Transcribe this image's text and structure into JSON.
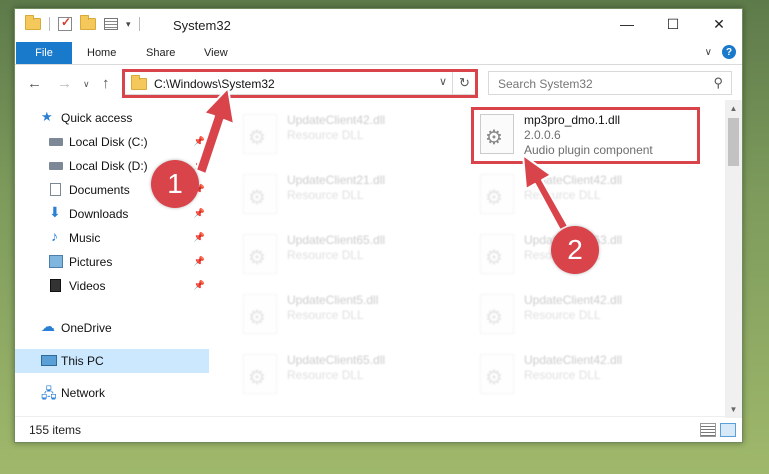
{
  "window": {
    "title": "System32",
    "controls": {
      "minimize": "—",
      "maximize": "☐",
      "close": "✕"
    }
  },
  "ribbon": {
    "file": "File",
    "tabs": [
      "Home",
      "Share",
      "View"
    ],
    "help": "?",
    "expand": "∨"
  },
  "nav": {
    "back": "←",
    "forward": "→",
    "recent": "∨",
    "up": "↑"
  },
  "address": {
    "path": "C:\\Windows\\System32",
    "dropdown": "∨",
    "refresh": "↻"
  },
  "search": {
    "placeholder": "Search System32",
    "icon": "⚲"
  },
  "sidebar": {
    "items": [
      {
        "label": "Quick access",
        "icon": "star-icon",
        "pinned": false
      },
      {
        "label": "Local Disk (C:)",
        "icon": "drive-icon",
        "pinned": true
      },
      {
        "label": "Local Disk (D:)",
        "icon": "drive-icon",
        "pinned": true
      },
      {
        "label": "Documents",
        "icon": "documents-icon",
        "pinned": true
      },
      {
        "label": "Downloads",
        "icon": "downloads-icon",
        "pinned": true
      },
      {
        "label": "Music",
        "icon": "music-icon",
        "pinned": true
      },
      {
        "label": "Pictures",
        "icon": "pictures-icon",
        "pinned": true
      },
      {
        "label": "Videos",
        "icon": "videos-icon",
        "pinned": true
      },
      {
        "label": "OneDrive",
        "icon": "onedrive-icon",
        "pinned": false
      },
      {
        "label": "This PC",
        "icon": "this-pc-icon",
        "pinned": false,
        "selected": true
      },
      {
        "label": "Network",
        "icon": "network-icon",
        "pinned": false
      }
    ],
    "pin_glyph": "📌"
  },
  "files": {
    "left_column": [
      {
        "name": "UpdateClient42.dll",
        "type": "Resource DLL"
      },
      {
        "name": "UpdateClient21.dll",
        "type": "Resource DLL"
      },
      {
        "name": "UpdateClient65.dll",
        "type": "Resource DLL"
      },
      {
        "name": "UpdateClient5.dll",
        "type": "Resource DLL"
      },
      {
        "name": "UpdateClient65.dll",
        "type": "Resource DLL"
      }
    ],
    "right_column": [
      {
        "name": "mp3pro_dmo.1.dll",
        "version": "2.0.0.6",
        "description": "Audio plugin component",
        "highlighted": true
      },
      {
        "name": "UpdateClient42.dll",
        "type": "Resource DLL"
      },
      {
        "name": "UpdateClient63.dll",
        "type": "Resource DLL"
      },
      {
        "name": "UpdateClient42.dll",
        "type": "Resource DLL"
      },
      {
        "name": "UpdateClient42.dll",
        "type": "Resource DLL"
      }
    ]
  },
  "status": {
    "items_count": "155 items"
  },
  "annotations": {
    "step1": "1",
    "step2": "2",
    "color": "#d9434a"
  }
}
